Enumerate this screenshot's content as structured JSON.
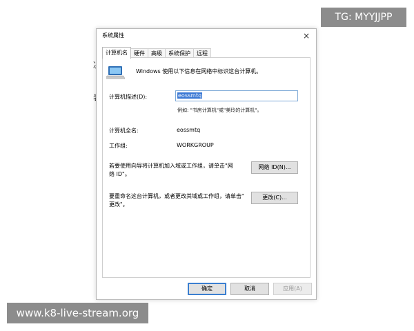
{
  "watermarks": {
    "top_right": "TG: MYYJJPP",
    "bottom_left": "www.k8-live-stream.org"
  },
  "background": {
    "fragment_1": "决",
    "fragment_2": "表"
  },
  "dialog": {
    "title": "系统属性",
    "close_symbol": "×",
    "tabs": [
      "计算机名",
      "硬件",
      "高级",
      "系统保护",
      "远程"
    ],
    "intro": "Windows 使用以下信息在网络中标识这台计算机。",
    "description_label": "计算机描述(D):",
    "description_value": "eossmtq",
    "description_hint": "例如: \"书房计算机\"或\"美玲的计算机\"。",
    "full_name_label": "计算机全名:",
    "full_name_value": "eossmtq",
    "workgroup_label": "工作组:",
    "workgroup_value": "WORKGROUP",
    "network_text_line1": "若要使用向导将计算机加入域或工作组，请单击\"网",
    "network_text_line2": "络 ID\"。",
    "network_id_button": "网络 ID(N)...",
    "rename_text_line1": "要重命名这台计算机，或者更改其域或工作组，请单击\"",
    "rename_text_line2": "更改\"。",
    "change_button": "更改(C)...",
    "ok_button": "确定",
    "cancel_button": "取消",
    "apply_button": "应用(A)"
  }
}
